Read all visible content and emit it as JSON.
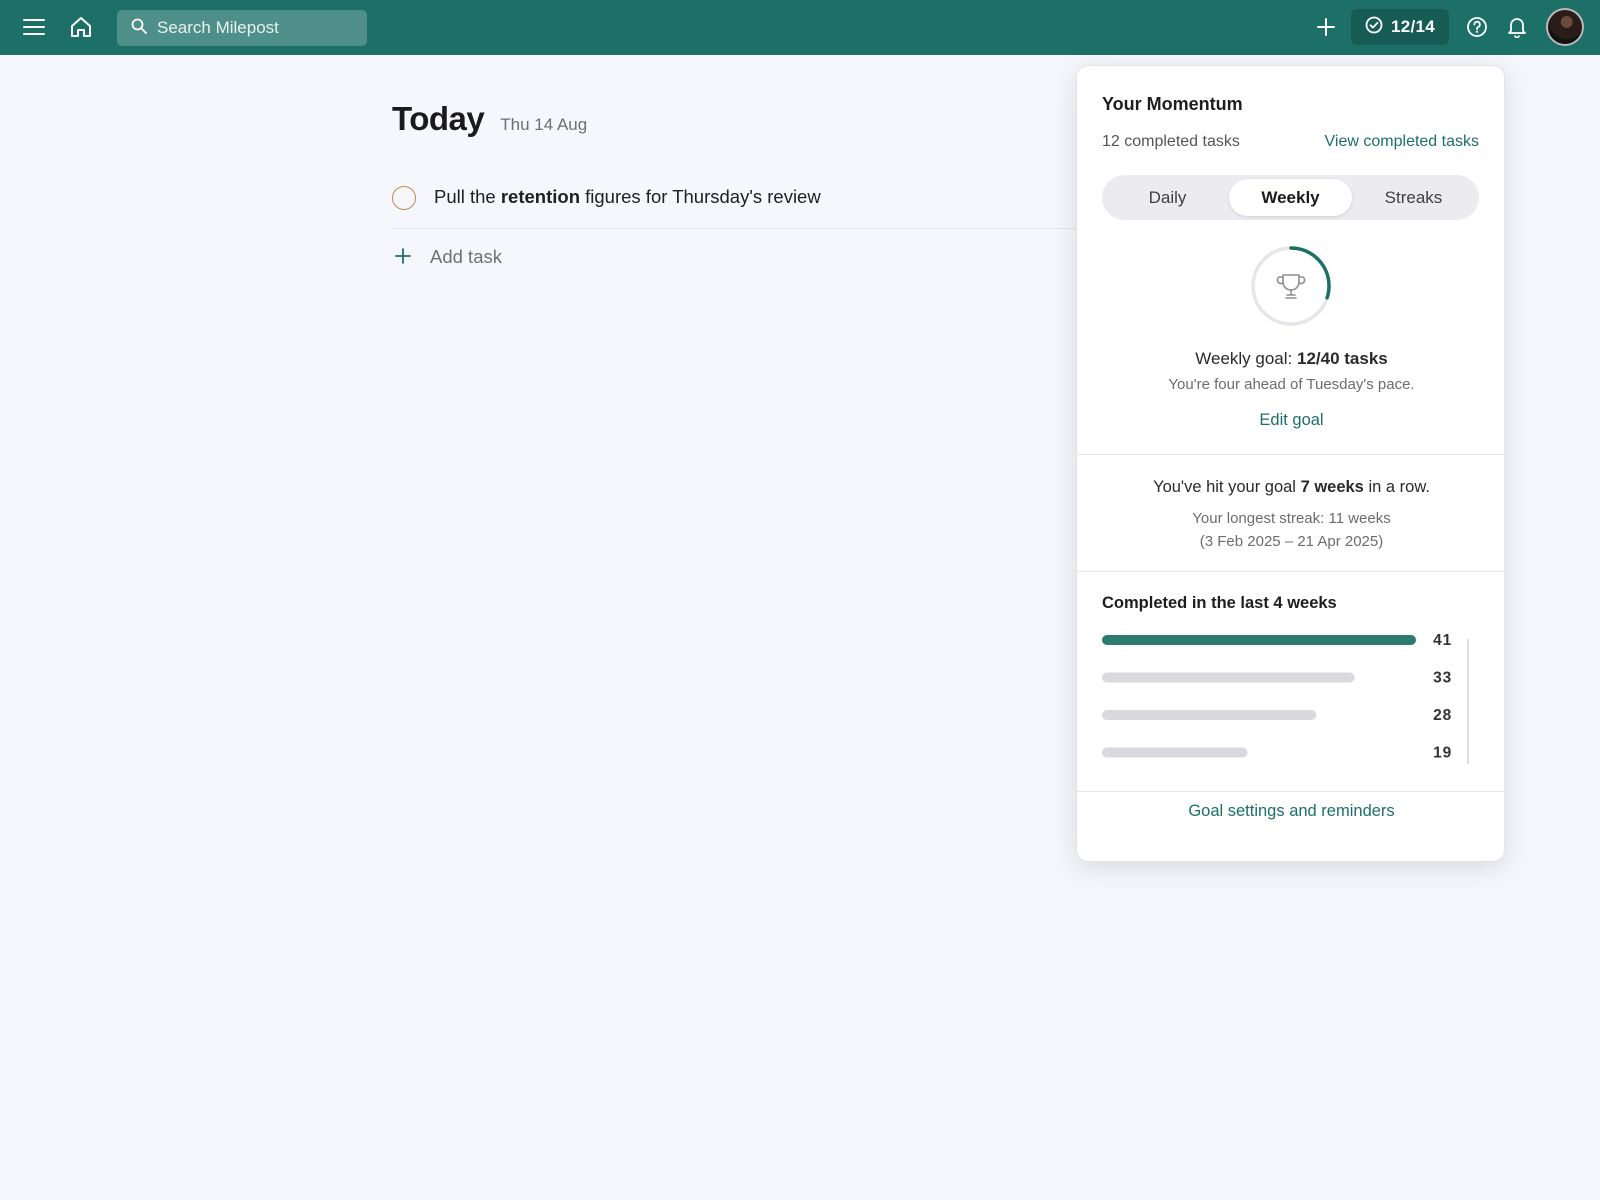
{
  "topbar": {
    "search_placeholder": "Search Milepost",
    "progress_count": "12/14",
    "icons": [
      "menu-icon",
      "home-icon",
      "search-icon",
      "add-icon",
      "check-circle-icon",
      "help-icon",
      "bell-icon"
    ],
    "brand_color": "#1d7068"
  },
  "today": {
    "title": "Today",
    "date": "Thu 14 Aug",
    "task": {
      "prefix": "Pull the ",
      "bold": "retention",
      "suffix": " figures for Thursday's review"
    },
    "add_task_label": "Add task"
  },
  "momentum": {
    "title": "Your Momentum",
    "completed_text": "12 completed tasks",
    "view_completed_label": "View completed tasks",
    "tabs": [
      {
        "label": "Daily"
      },
      {
        "label": "Weekly"
      },
      {
        "label": "Streaks"
      }
    ],
    "active_tab": "Weekly",
    "goal_progress": {
      "done": 12,
      "target": 40
    },
    "goal_prefix": "Weekly goal: ",
    "goal_value": "12/40 tasks",
    "pace_text": "You're four ahead of Tuesday's pace.",
    "edit_goal_label": "Edit goal",
    "streak_prefix": "You've hit your goal ",
    "streak_value": "7 weeks",
    "streak_suffix": " in a row.",
    "longest_line1": "Your longest streak: 11 weeks",
    "longest_line2": "(3 Feb 2025 – 21 Apr 2025)",
    "weeks_title": "Completed in the last 4 weeks",
    "footer_link": "Goal settings and reminders"
  },
  "chart_data": {
    "type": "bar",
    "title": "Completed in the last 4 weeks",
    "values": [
      41,
      33,
      28,
      19
    ],
    "xlim": [
      0,
      41
    ],
    "highlight_index": 0,
    "colors": {
      "highlight": "#2d7b70",
      "default": "#d9d9de"
    }
  }
}
